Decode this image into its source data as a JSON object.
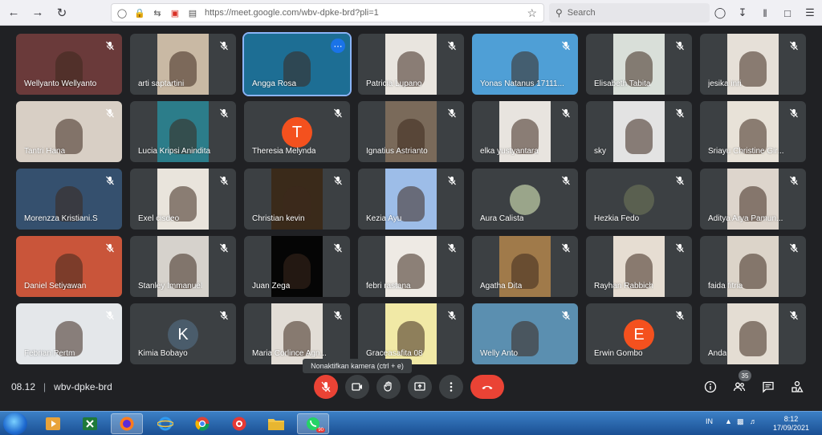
{
  "browser": {
    "url": "https://meet.google.com/wbv-dpke-brd?pli=1",
    "search_placeholder": "Search"
  },
  "tiles": [
    {
      "name": "Wellyanto Wellyanto",
      "bg": "#6a3a3a"
    },
    {
      "name": "arti saptartini",
      "bg": "#c9b9a4"
    },
    {
      "name": "Angga Rosa",
      "bg": "#1d6e94"
    },
    {
      "name": "Patricia Lupano",
      "bg": "#e9e5df"
    },
    {
      "name": "Yonas Natanus 17111...",
      "bg": "#4f9fd6"
    },
    {
      "name": "Elisabeth Tabita",
      "bg": "#d9dfd9"
    },
    {
      "name": "jesika inri",
      "bg": "#e6e0d8"
    },
    {
      "name": "Tantri Hana",
      "bg": "#d8cfc5"
    },
    {
      "name": "Lucia Kripsi Anindita",
      "bg": "#2c7d8a"
    },
    {
      "name": "Theresia Melynda",
      "bg": "#3c4043",
      "avatar": "T",
      "avatar_color": "#f4511e"
    },
    {
      "name": "Ignatius Astrianto",
      "bg": "#7a6a5a"
    },
    {
      "name": "elka yustyantara",
      "bg": "#e8e4df"
    },
    {
      "name": "sky",
      "bg": "#e3e3e3"
    },
    {
      "name": "Sriayu Christine Gir...",
      "bg": "#e8e2d8"
    },
    {
      "name": "Morenzza Kristiani.S",
      "bg": "#35506e"
    },
    {
      "name": "Exel cisdeo",
      "bg": "#e9e4dc"
    },
    {
      "name": "Christian kevin",
      "bg": "#3a2a1a"
    },
    {
      "name": "Kezia Ayu",
      "bg": "#9dbde8"
    },
    {
      "name": "Aura Calista",
      "bg": "#3c4043",
      "round": "#9aa58a"
    },
    {
      "name": "Hezkia Fedo",
      "bg": "#3c4043",
      "round": "#5a6050"
    },
    {
      "name": "Aditya Arya Pamun...",
      "bg": "#ddd5cc"
    },
    {
      "name": "Daniel Setiyawan",
      "bg": "#c9553a"
    },
    {
      "name": "Stanley Immanuel",
      "bg": "#d6d2cc"
    },
    {
      "name": "Juan Zega",
      "bg": "#050505"
    },
    {
      "name": "febri rastana",
      "bg": "#eeeae4"
    },
    {
      "name": "Agatha Dita",
      "bg": "#a07a4a"
    },
    {
      "name": "Rayhan Rabbich",
      "bg": "#e6ddd2"
    },
    {
      "name": "faida fitria",
      "bg": "#dcd4c9"
    },
    {
      "name": "Febrian Pertm",
      "bg": "#e4e7ea"
    },
    {
      "name": "Kimia Bobayo",
      "bg": "#3c4043",
      "avatar": "K",
      "avatar_color": "#4a5c6b"
    },
    {
      "name": "Maria Corlince Agn...",
      "bg": "#e2ddd6"
    },
    {
      "name": "Graceasafita 08",
      "bg": "#f1e9a6"
    },
    {
      "name": "Welly Anto",
      "bg": "#5b8fb0"
    },
    {
      "name": "Erwin Gombo",
      "bg": "#3c4043",
      "avatar": "E",
      "avatar_color": "#f4511e"
    },
    {
      "name": "Anda",
      "bg": "#e4ddd3"
    }
  ],
  "meeting": {
    "time": "08.12",
    "code": "wbv-dpke-brd",
    "tooltip": "Nonaktifkan kamera (ctrl + e)",
    "participants_badge": "35"
  },
  "taskbar": {
    "lang": "IN",
    "time": "8:12",
    "date": "17/09/2021",
    "whatsapp_badge": "90"
  }
}
